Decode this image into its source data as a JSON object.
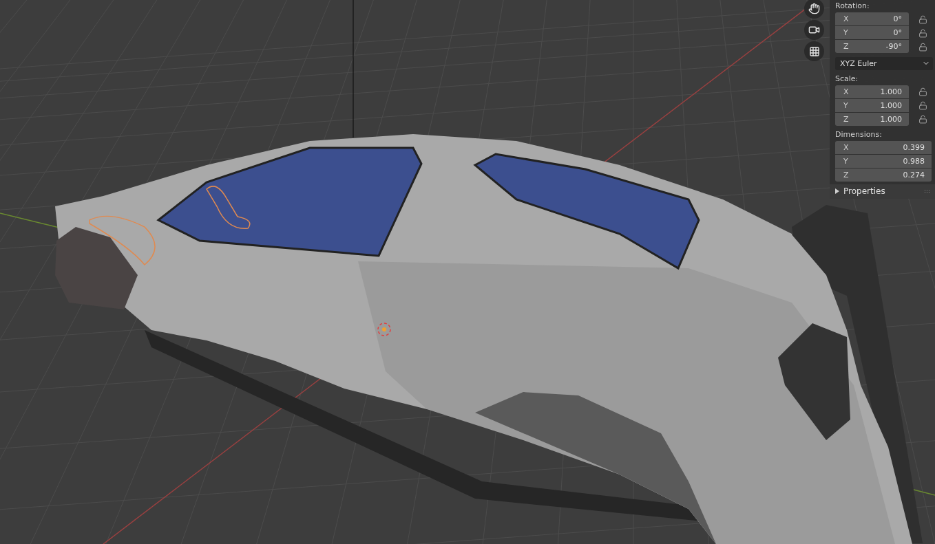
{
  "rotation": {
    "label": "Rotation:",
    "fields": [
      {
        "axis": "X",
        "value": "0°",
        "locked": false
      },
      {
        "axis": "Y",
        "value": "0°",
        "locked": false
      },
      {
        "axis": "Z",
        "value": "-90°",
        "locked": false
      }
    ]
  },
  "rotation_mode": {
    "value": "XYZ Euler"
  },
  "scale": {
    "label": "Scale:",
    "fields": [
      {
        "axis": "X",
        "value": "1.000",
        "locked": false
      },
      {
        "axis": "Y",
        "value": "1.000",
        "locked": false
      },
      {
        "axis": "Z",
        "value": "1.000",
        "locked": false
      }
    ]
  },
  "dimensions": {
    "label": "Dimensions:",
    "fields": [
      {
        "axis": "X",
        "value": "0.399"
      },
      {
        "axis": "Y",
        "value": "0.988"
      },
      {
        "axis": "Z",
        "value": "0.274"
      }
    ]
  },
  "properties_panel": {
    "title": "Properties",
    "expanded": false
  }
}
